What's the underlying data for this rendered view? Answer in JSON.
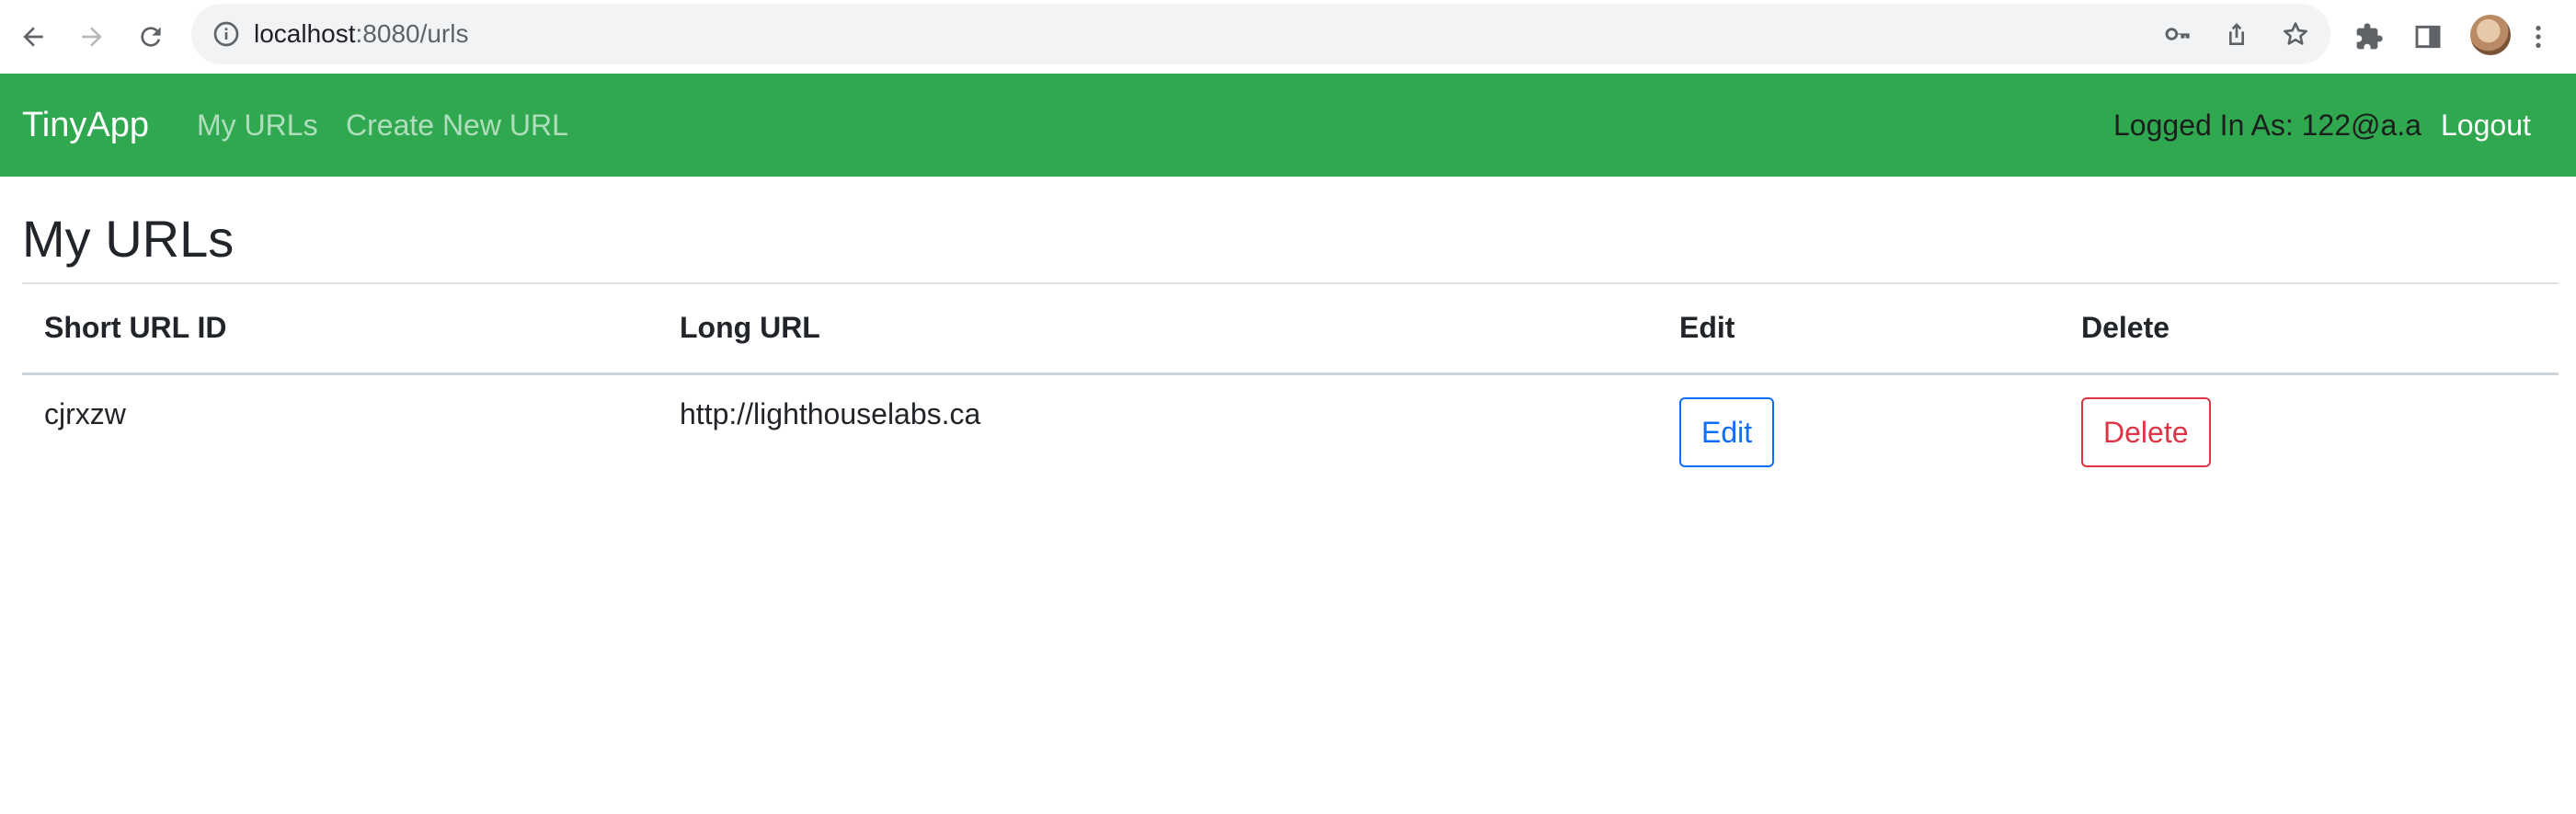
{
  "browser": {
    "url_host": "localhost",
    "url_path": ":8080/urls"
  },
  "navbar": {
    "brand": "TinyApp",
    "links": [
      {
        "label": "My URLs"
      },
      {
        "label": "Create New URL"
      }
    ],
    "logged_in_text": "Logged In As: 122@a.a",
    "logout_label": "Logout",
    "background": "#2fa84f"
  },
  "main": {
    "title": "My URLs",
    "table": {
      "headers": [
        "Short URL ID",
        "Long URL",
        "Edit",
        "Delete"
      ],
      "rows": [
        {
          "short_id": "cjrxzw",
          "long_url": "http://lighthouselabs.ca",
          "edit_label": "Edit",
          "delete_label": "Delete"
        }
      ]
    }
  },
  "colors": {
    "edit": "#0d6efd",
    "delete": "#dc3545"
  },
  "icons": [
    "back-icon",
    "forward-icon",
    "reload-icon",
    "info-icon",
    "key-icon",
    "share-icon",
    "star-icon",
    "extensions-icon",
    "side-panel-icon",
    "more-icon"
  ]
}
